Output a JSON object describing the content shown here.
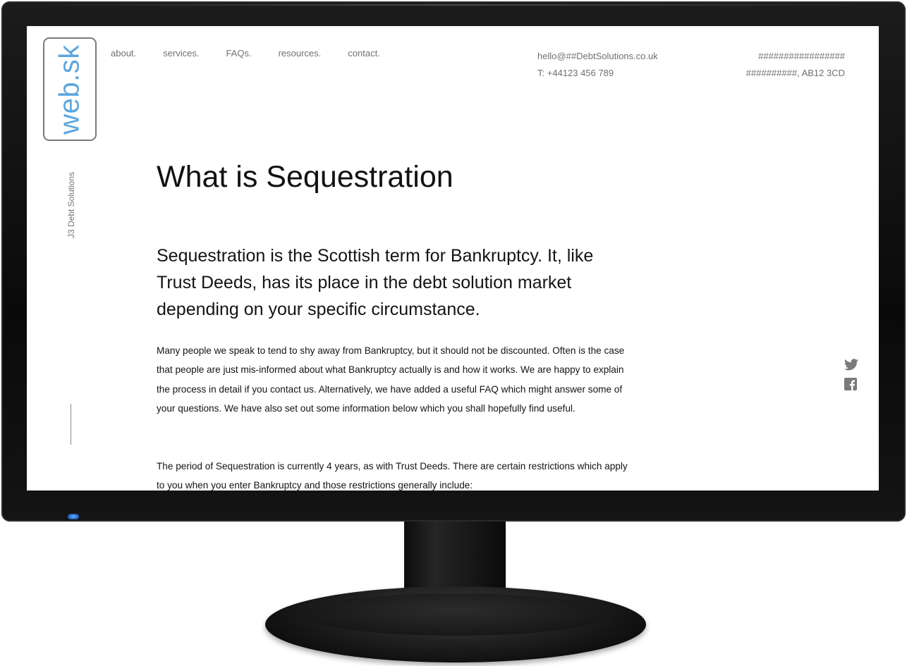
{
  "brand": {
    "logo_text": "web.sk",
    "tagline": "J3 Debt Solutions",
    "accent_color": "#5ea6de"
  },
  "nav": {
    "items": [
      "about.",
      "services.",
      "FAQs.",
      "resources.",
      "contact."
    ]
  },
  "contact": {
    "email": "hello@##DebtSolutions.co.uk",
    "phone": "T: +44123 456 789"
  },
  "address": {
    "line1": "#################",
    "line2": "##########, AB12 3CD"
  },
  "page": {
    "title": "What is Sequestration",
    "lead": "Sequestration is the Scottish term for Bankruptcy. It, like Trust Deeds, has its place in the debt solution market depending on your specific circumstance.",
    "paragraph1": "Many people we speak to tend to shy away from Bankruptcy, but it should not be discounted. Often is the case that people are just mis-informed about what Bankruptcy actually is and how it works. We are happy to explain the process in detail if you contact us. Alternatively, we have added a useful FAQ which might answer some of your questions. We have also set out some information below which you shall hopefully find useful.",
    "paragraph2": "The period of Sequestration is currently 4 years, as with Trust Deeds. There are certain restrictions which apply to you when you enter Bankruptcy and those restrictions generally include:"
  },
  "social": {
    "icons": [
      "twitter-icon",
      "facebook-icon"
    ]
  }
}
